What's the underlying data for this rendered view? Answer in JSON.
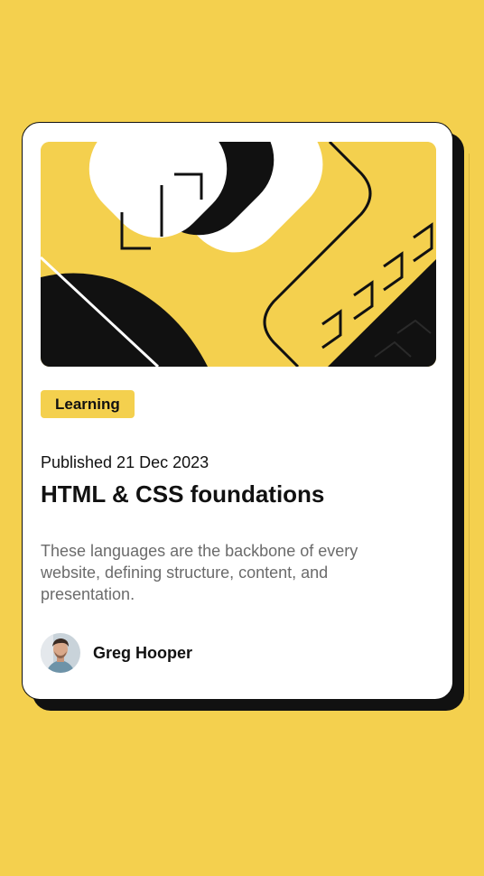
{
  "colors": {
    "background": "#F4D04E",
    "card": "#FFFFFF",
    "ink": "#111111",
    "muted": "#6B6B6B"
  },
  "card": {
    "illustration_icon": "abstract-yellow-illustration",
    "tag": "Learning",
    "published": "Published 21 Dec 2023",
    "title": "HTML & CSS foundations",
    "description": "These languages are the backbone of every website, defining structure, content, and presentation.",
    "author": {
      "avatar_icon": "avatar-photo",
      "name": "Greg Hooper"
    }
  }
}
